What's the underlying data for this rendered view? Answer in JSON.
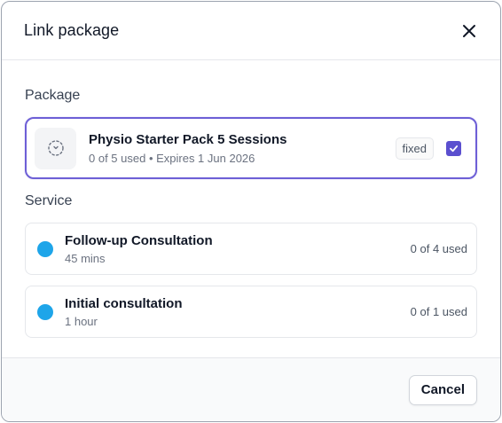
{
  "dialog": {
    "title": "Link package"
  },
  "package_section": {
    "label": "Package",
    "package": {
      "name": "Physio Starter Pack 5 Sessions",
      "meta": "0 of 5 used • Expires 1 Jun 2026",
      "badge": "fixed",
      "checked": true,
      "icon": "package-scan-icon"
    }
  },
  "service_section": {
    "label": "Service",
    "services": [
      {
        "name": "Follow-up Consultation",
        "duration": "45 mins",
        "usage": "0 of 4 used",
        "color": "#1ea5e9"
      },
      {
        "name": "Initial consultation",
        "duration": "1 hour",
        "usage": "0 of 1 used",
        "color": "#1ea5e9"
      }
    ]
  },
  "footer": {
    "cancel_label": "Cancel"
  },
  "colors": {
    "accent": "#5b4fcf",
    "selected_border": "#6d5fd6",
    "service_dot": "#1ea5e9"
  }
}
